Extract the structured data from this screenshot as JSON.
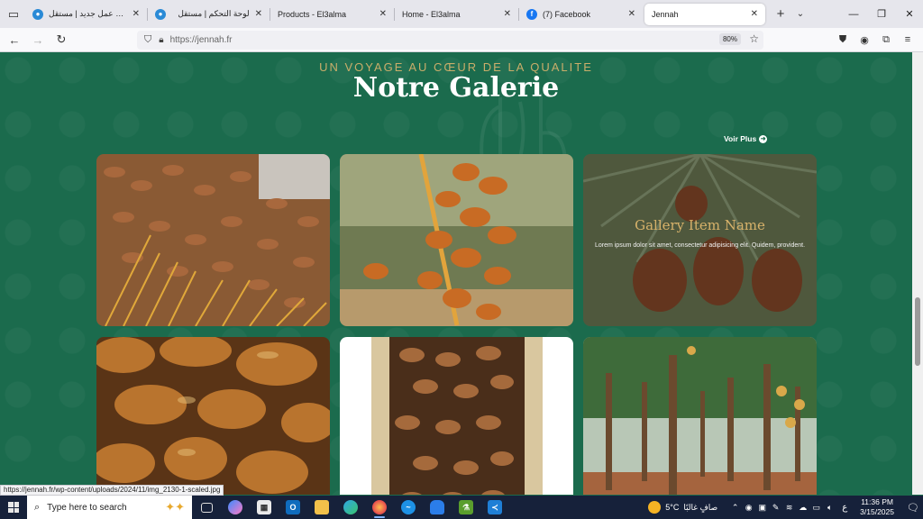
{
  "browser": {
    "tabs": [
      {
        "title": "إضافة عمل جديد | مستقل",
        "favicon_color": "#2a8ad6",
        "active": false
      },
      {
        "title": "لوحة التحكم | مستقل",
        "favicon_color": "#2a8ad6",
        "active": false
      },
      {
        "title": "Products - El3alma",
        "favicon_color": "",
        "active": false
      },
      {
        "title": "Home - El3alma",
        "favicon_color": "",
        "active": false
      },
      {
        "title": "(7) Facebook",
        "favicon_color": "#1877f2",
        "active": false
      },
      {
        "title": "Jennah",
        "favicon_color": "",
        "active": true
      }
    ],
    "url": "https://jennah.fr",
    "zoom": "80%",
    "status_link": "https://jennah.fr/wp-content/uploads/2024/11/img_2130-1-scaled.jpg"
  },
  "page": {
    "subtitle": "UN VOYAGE AU CŒUR DE LA QUALITE",
    "title": "Notre Galerie",
    "voir_plus": "Voir Plus",
    "gallery_overlay": {
      "name": "Gallery Item Name",
      "description": "Lorem ipsum dolor sit amet, consectetur adipisicing elit. Quidem, provident."
    },
    "colors": {
      "background": "#1b6b4d",
      "accent_gold": "#c9ad6a"
    }
  },
  "taskbar": {
    "search_placeholder": "Type here to search",
    "weather": {
      "temp": "5°C",
      "text": "صافٍ غالبًا"
    },
    "language": "ع",
    "time": "11:36 PM",
    "date": "3/15/2025"
  }
}
